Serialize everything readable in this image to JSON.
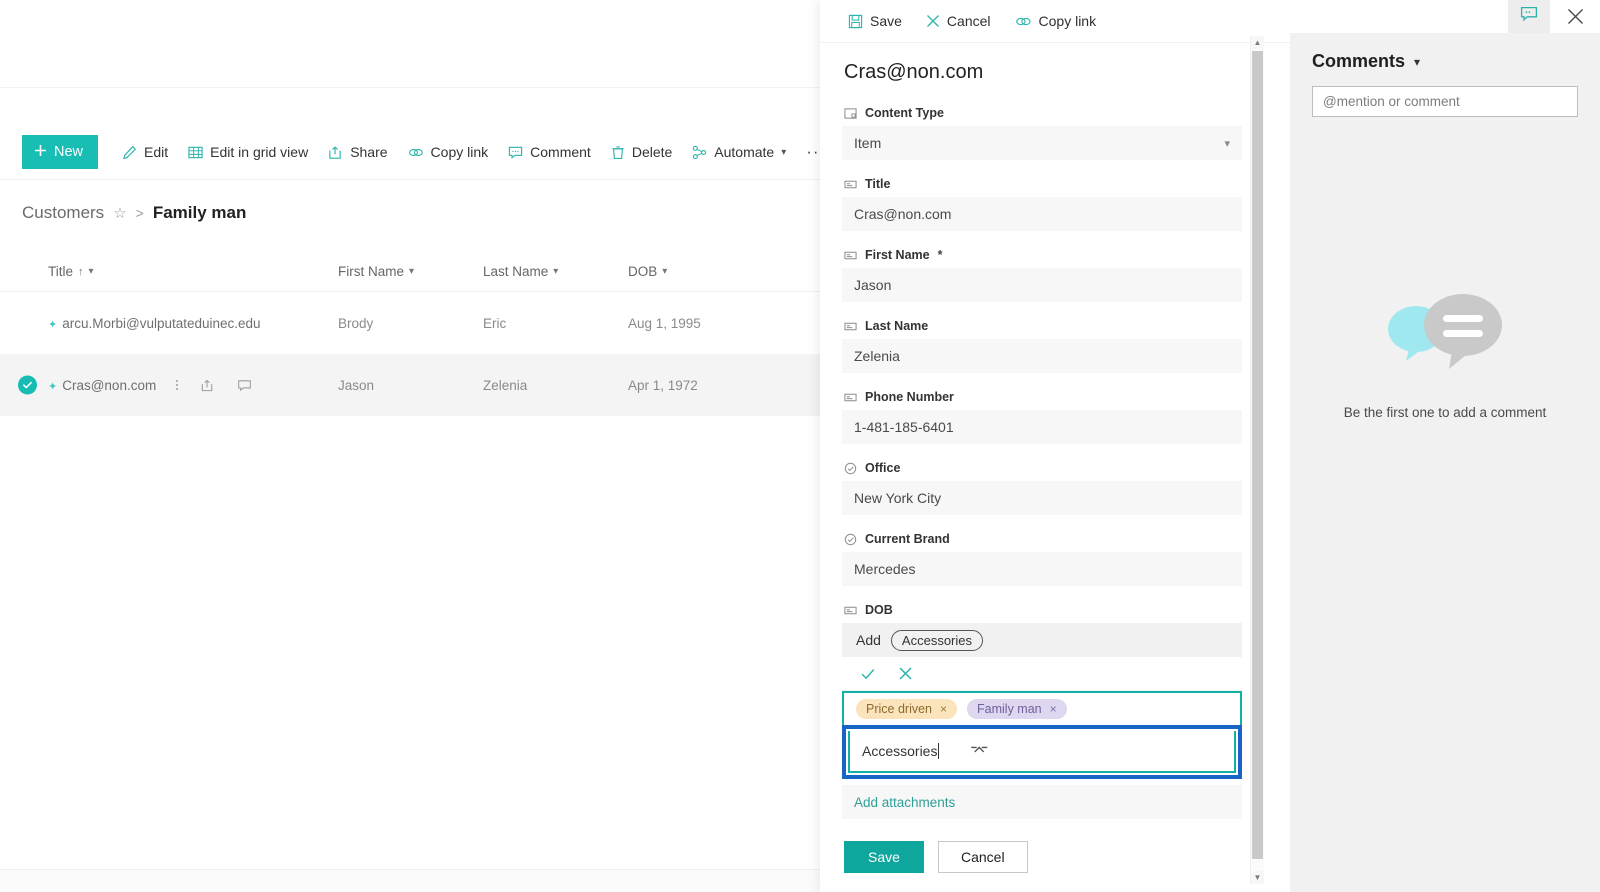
{
  "list": {
    "commands": [
      {
        "label": "New",
        "icon": "plus-icon"
      },
      {
        "label": "Edit",
        "icon": "pencil-icon"
      },
      {
        "label": "Edit in grid view",
        "icon": "grid-icon"
      },
      {
        "label": "Share",
        "icon": "share-icon"
      },
      {
        "label": "Copy link",
        "icon": "link-icon"
      },
      {
        "label": "Comment",
        "icon": "comment-icon"
      },
      {
        "label": "Delete",
        "icon": "trash-icon"
      },
      {
        "label": "Automate",
        "icon": "automate-icon"
      }
    ],
    "overflow_label": "···",
    "breadcrumb": {
      "root": "Customers",
      "separator": ">",
      "current": "Family man"
    },
    "columns": [
      {
        "label": "Title",
        "sorted": "↑"
      },
      {
        "label": "First Name"
      },
      {
        "label": "Last Name"
      },
      {
        "label": "DOB"
      }
    ],
    "rows": [
      {
        "title": "arcu.Morbi@vulputateduinec.edu",
        "first_name": "Brody",
        "last_name": "Eric",
        "dob": "Aug 1, 1995",
        "selected": false
      },
      {
        "title": "Cras@non.com",
        "first_name": "Jason",
        "last_name": "Zelenia",
        "dob": "Apr 1, 1972",
        "selected": true
      }
    ]
  },
  "form": {
    "commands": [
      {
        "label": "Save",
        "icon": "save-icon"
      },
      {
        "label": "Cancel",
        "icon": "close-icon"
      },
      {
        "label": "Copy link",
        "icon": "link-icon"
      }
    ],
    "item_title": "Cras@non.com",
    "fields": [
      {
        "label": "Content Type",
        "value": "Item",
        "icon": "content-type-icon",
        "type": "dropdown",
        "required": false
      },
      {
        "label": "Title",
        "value": "Cras@non.com",
        "icon": "text-icon",
        "type": "text",
        "required": false
      },
      {
        "label": "First Name",
        "value": "Jason",
        "icon": "text-icon",
        "type": "text",
        "required": true
      },
      {
        "label": "Last Name",
        "value": "Zelenia",
        "icon": "text-icon",
        "type": "text",
        "required": false
      },
      {
        "label": "Phone Number",
        "value": "1-481-185-6401",
        "icon": "text-icon",
        "type": "text",
        "required": false
      },
      {
        "label": "Office",
        "value": "New York City",
        "icon": "choice-icon",
        "type": "choice",
        "required": false
      },
      {
        "label": "Current Brand",
        "value": "Mercedes",
        "icon": "choice-icon",
        "type": "choice",
        "required": false
      }
    ],
    "required_marker": "*",
    "tag_field": {
      "label": "DOB",
      "icon": "text-icon",
      "suggestion_prefix": "Add",
      "suggestion_value": "Accessories",
      "tags": [
        {
          "label": "Price driven",
          "remove": "×",
          "color": "#fbe3bb",
          "text_color": "#8a6d2f"
        },
        {
          "label": "Family man",
          "remove": "×",
          "color": "#ded7ef",
          "text_color": "#6e5f9b"
        }
      ],
      "input_value": "Accessories"
    },
    "attachments_label": "Add attachments",
    "save_label": "Save",
    "cancel_label": "Cancel",
    "accent_color": "#0fa69d"
  },
  "comments": {
    "panel_title": "Comments",
    "collapse_chevron": "⌵",
    "input_placeholder": "@mention or comment",
    "input_value": "",
    "empty_text": "Be the first one to add a comment",
    "close_label": "×"
  }
}
